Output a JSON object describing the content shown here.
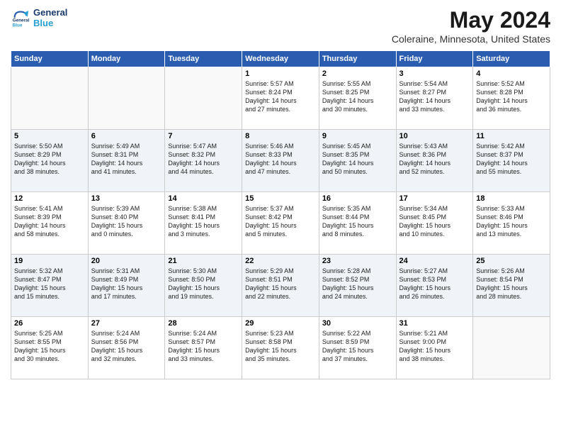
{
  "header": {
    "logo_line1": "General",
    "logo_line2": "Blue",
    "month": "May 2024",
    "location": "Coleraine, Minnesota, United States"
  },
  "weekdays": [
    "Sunday",
    "Monday",
    "Tuesday",
    "Wednesday",
    "Thursday",
    "Friday",
    "Saturday"
  ],
  "weeks": [
    [
      {
        "day": "",
        "text": ""
      },
      {
        "day": "",
        "text": ""
      },
      {
        "day": "",
        "text": ""
      },
      {
        "day": "1",
        "text": "Sunrise: 5:57 AM\nSunset: 8:24 PM\nDaylight: 14 hours\nand 27 minutes."
      },
      {
        "day": "2",
        "text": "Sunrise: 5:55 AM\nSunset: 8:25 PM\nDaylight: 14 hours\nand 30 minutes."
      },
      {
        "day": "3",
        "text": "Sunrise: 5:54 AM\nSunset: 8:27 PM\nDaylight: 14 hours\nand 33 minutes."
      },
      {
        "day": "4",
        "text": "Sunrise: 5:52 AM\nSunset: 8:28 PM\nDaylight: 14 hours\nand 36 minutes."
      }
    ],
    [
      {
        "day": "5",
        "text": "Sunrise: 5:50 AM\nSunset: 8:29 PM\nDaylight: 14 hours\nand 38 minutes."
      },
      {
        "day": "6",
        "text": "Sunrise: 5:49 AM\nSunset: 8:31 PM\nDaylight: 14 hours\nand 41 minutes."
      },
      {
        "day": "7",
        "text": "Sunrise: 5:47 AM\nSunset: 8:32 PM\nDaylight: 14 hours\nand 44 minutes."
      },
      {
        "day": "8",
        "text": "Sunrise: 5:46 AM\nSunset: 8:33 PM\nDaylight: 14 hours\nand 47 minutes."
      },
      {
        "day": "9",
        "text": "Sunrise: 5:45 AM\nSunset: 8:35 PM\nDaylight: 14 hours\nand 50 minutes."
      },
      {
        "day": "10",
        "text": "Sunrise: 5:43 AM\nSunset: 8:36 PM\nDaylight: 14 hours\nand 52 minutes."
      },
      {
        "day": "11",
        "text": "Sunrise: 5:42 AM\nSunset: 8:37 PM\nDaylight: 14 hours\nand 55 minutes."
      }
    ],
    [
      {
        "day": "12",
        "text": "Sunrise: 5:41 AM\nSunset: 8:39 PM\nDaylight: 14 hours\nand 58 minutes."
      },
      {
        "day": "13",
        "text": "Sunrise: 5:39 AM\nSunset: 8:40 PM\nDaylight: 15 hours\nand 0 minutes."
      },
      {
        "day": "14",
        "text": "Sunrise: 5:38 AM\nSunset: 8:41 PM\nDaylight: 15 hours\nand 3 minutes."
      },
      {
        "day": "15",
        "text": "Sunrise: 5:37 AM\nSunset: 8:42 PM\nDaylight: 15 hours\nand 5 minutes."
      },
      {
        "day": "16",
        "text": "Sunrise: 5:35 AM\nSunset: 8:44 PM\nDaylight: 15 hours\nand 8 minutes."
      },
      {
        "day": "17",
        "text": "Sunrise: 5:34 AM\nSunset: 8:45 PM\nDaylight: 15 hours\nand 10 minutes."
      },
      {
        "day": "18",
        "text": "Sunrise: 5:33 AM\nSunset: 8:46 PM\nDaylight: 15 hours\nand 13 minutes."
      }
    ],
    [
      {
        "day": "19",
        "text": "Sunrise: 5:32 AM\nSunset: 8:47 PM\nDaylight: 15 hours\nand 15 minutes."
      },
      {
        "day": "20",
        "text": "Sunrise: 5:31 AM\nSunset: 8:49 PM\nDaylight: 15 hours\nand 17 minutes."
      },
      {
        "day": "21",
        "text": "Sunrise: 5:30 AM\nSunset: 8:50 PM\nDaylight: 15 hours\nand 19 minutes."
      },
      {
        "day": "22",
        "text": "Sunrise: 5:29 AM\nSunset: 8:51 PM\nDaylight: 15 hours\nand 22 minutes."
      },
      {
        "day": "23",
        "text": "Sunrise: 5:28 AM\nSunset: 8:52 PM\nDaylight: 15 hours\nand 24 minutes."
      },
      {
        "day": "24",
        "text": "Sunrise: 5:27 AM\nSunset: 8:53 PM\nDaylight: 15 hours\nand 26 minutes."
      },
      {
        "day": "25",
        "text": "Sunrise: 5:26 AM\nSunset: 8:54 PM\nDaylight: 15 hours\nand 28 minutes."
      }
    ],
    [
      {
        "day": "26",
        "text": "Sunrise: 5:25 AM\nSunset: 8:55 PM\nDaylight: 15 hours\nand 30 minutes."
      },
      {
        "day": "27",
        "text": "Sunrise: 5:24 AM\nSunset: 8:56 PM\nDaylight: 15 hours\nand 32 minutes."
      },
      {
        "day": "28",
        "text": "Sunrise: 5:24 AM\nSunset: 8:57 PM\nDaylight: 15 hours\nand 33 minutes."
      },
      {
        "day": "29",
        "text": "Sunrise: 5:23 AM\nSunset: 8:58 PM\nDaylight: 15 hours\nand 35 minutes."
      },
      {
        "day": "30",
        "text": "Sunrise: 5:22 AM\nSunset: 8:59 PM\nDaylight: 15 hours\nand 37 minutes."
      },
      {
        "day": "31",
        "text": "Sunrise: 5:21 AM\nSunset: 9:00 PM\nDaylight: 15 hours\nand 38 minutes."
      },
      {
        "day": "",
        "text": ""
      }
    ]
  ]
}
